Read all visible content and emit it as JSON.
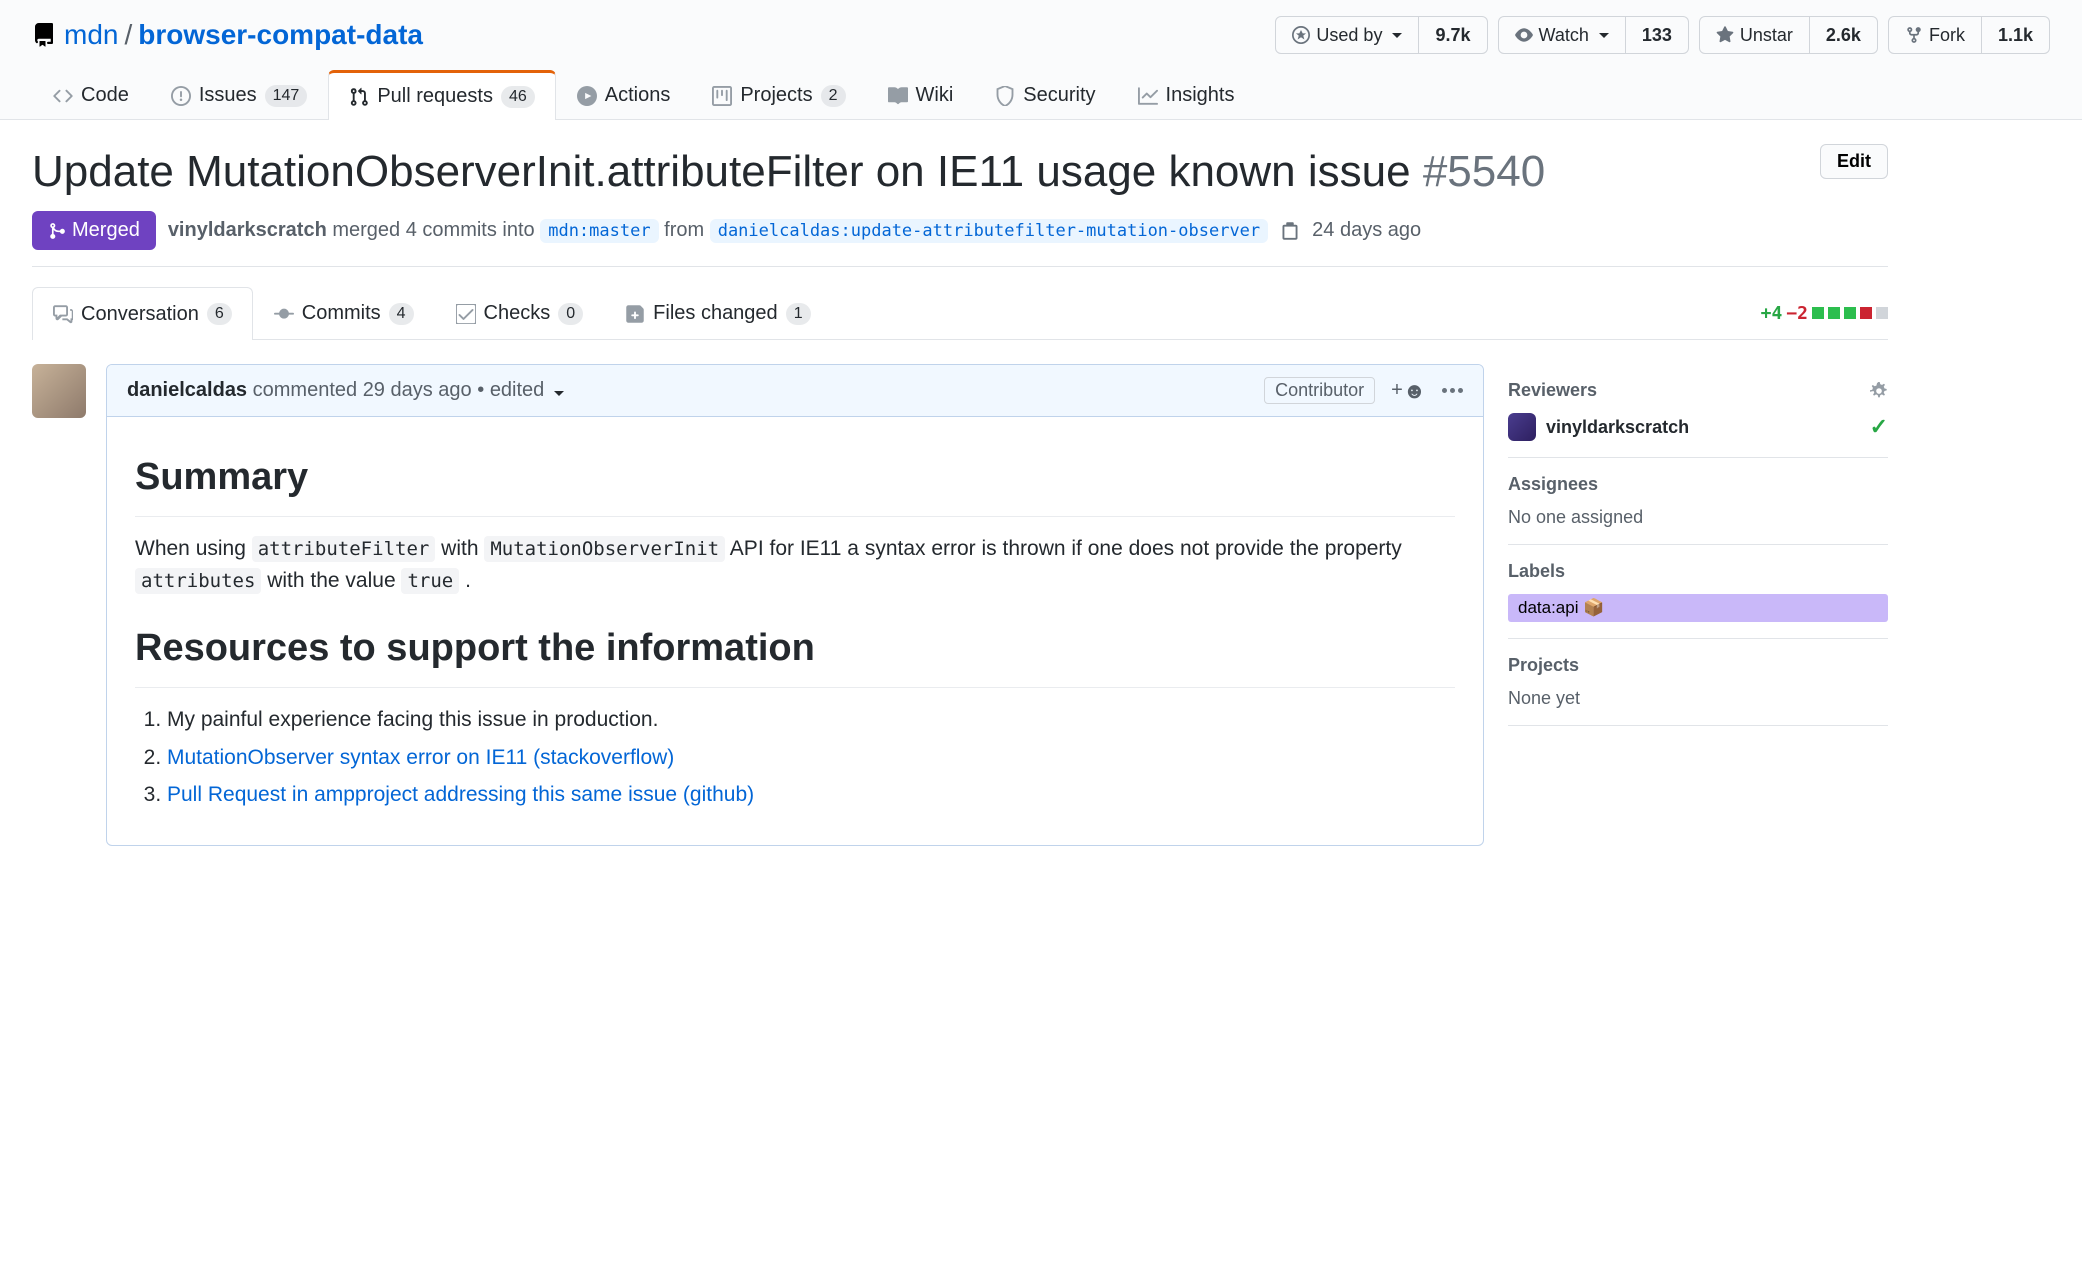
{
  "repo": {
    "owner": "mdn",
    "name": "browser-compat-data"
  },
  "actions": {
    "usedby": {
      "label": "Used by",
      "count": "9.7k"
    },
    "watch": {
      "label": "Watch",
      "count": "133"
    },
    "star": {
      "label": "Unstar",
      "count": "2.6k"
    },
    "fork": {
      "label": "Fork",
      "count": "1.1k"
    }
  },
  "nav": {
    "code": "Code",
    "issues": {
      "label": "Issues",
      "count": "147"
    },
    "pulls": {
      "label": "Pull requests",
      "count": "46"
    },
    "actions": "Actions",
    "projects": {
      "label": "Projects",
      "count": "2"
    },
    "wiki": "Wiki",
    "security": "Security",
    "insights": "Insights"
  },
  "pr": {
    "title": "Update MutationObserverInit.attributeFilter on IE11 usage known issue",
    "number": "#5540",
    "edit": "Edit",
    "state": "Merged",
    "merger": "vinyldarkscratch",
    "merge_text1": "merged 4 commits into",
    "base_branch": "mdn:master",
    "merge_text2": "from",
    "head_branch": "danielcaldas:update-attributefilter-mutation-observer",
    "merge_time": "24 days ago"
  },
  "tabs": {
    "conversation": {
      "label": "Conversation",
      "count": "6"
    },
    "commits": {
      "label": "Commits",
      "count": "4"
    },
    "checks": {
      "label": "Checks",
      "count": "0"
    },
    "files": {
      "label": "Files changed",
      "count": "1"
    }
  },
  "diff": {
    "add": "+4",
    "del": "−2"
  },
  "comment": {
    "author": "danielcaldas",
    "verb": "commented",
    "when": "29 days ago",
    "edited": "edited",
    "role": "Contributor",
    "h_summary": "Summary",
    "p1a": "When using ",
    "c1": "attributeFilter",
    "p1b": " with ",
    "c2": "MutationObserverInit",
    "p1c": " API for IE11 a syntax error is thrown if one does not provide the property ",
    "c3": "attributes",
    "p1d": " with the value ",
    "c4": "true",
    "p1e": " .",
    "h_resources": "Resources to support the information",
    "li1": "My painful experience facing this issue in production.",
    "li2": "MutationObserver syntax error on IE11 (stackoverflow)",
    "li3": "Pull Request in ampproject addressing this same issue (github)"
  },
  "sidebar": {
    "reviewers_h": "Reviewers",
    "reviewer1": "vinyldarkscratch",
    "assignees_h": "Assignees",
    "assignees_v": "No one assigned",
    "labels_h": "Labels",
    "label1": "data:api 📦",
    "projects_h": "Projects",
    "projects_v": "None yet"
  }
}
